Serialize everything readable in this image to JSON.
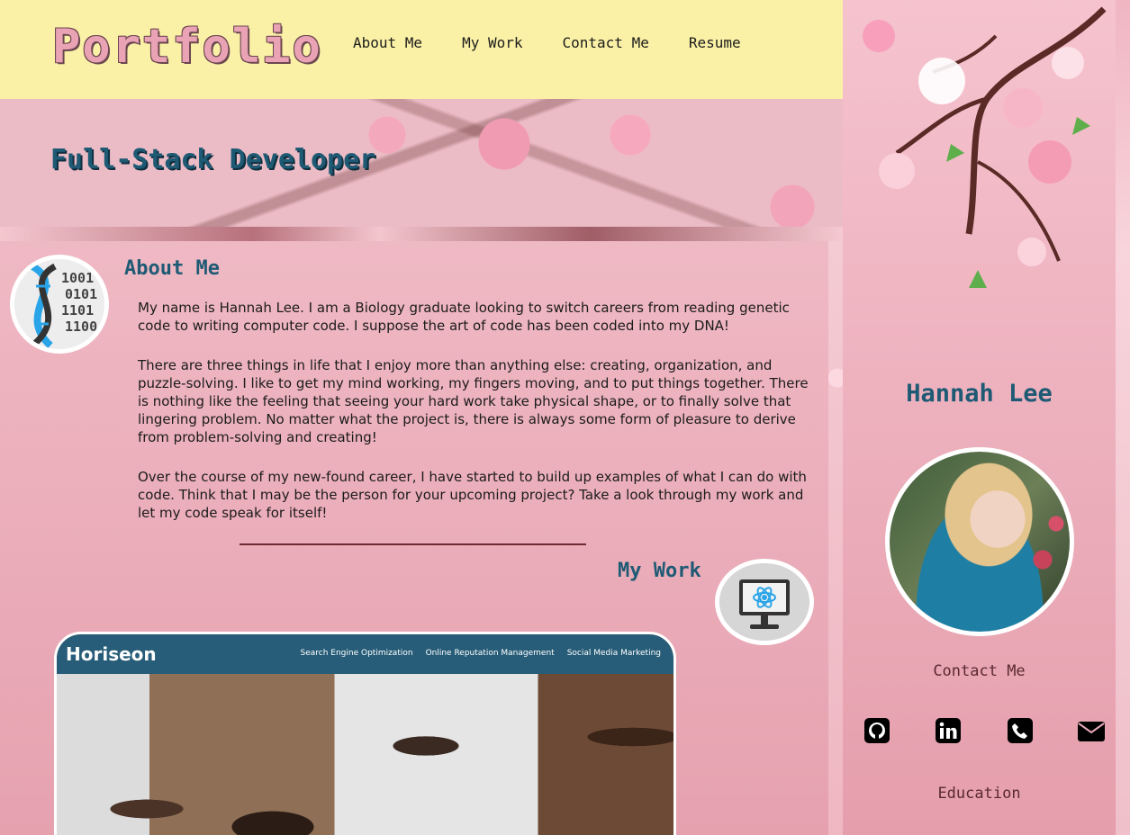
{
  "header": {
    "logo": "Portfolio",
    "nav": [
      "About Me",
      "My Work",
      "Contact Me",
      "Resume"
    ]
  },
  "hero": {
    "title": "Full-Stack Developer"
  },
  "about": {
    "heading": "About Me",
    "paragraphs": [
      "My name is Hannah Lee. I am a Biology graduate looking to switch careers from reading genetic code to writing computer code. I suppose the art of code has been coded into my DNA!",
      "There are three things in life that I enjoy more than anything else: creating, organization, and puzzle-solving. I like to get my mind working, my fingers moving, and to put things together. There is nothing like the feeling that seeing your hard work take physical shape, or to finally solve that lingering problem. No matter what the project is, there is always some form of pleasure to derive from problem-solving and creating!",
      "Over the course of my new-found career, I have started to build up examples of what I can do with code. Think that I may be the person for your upcoming project? Take a look through my work and let my code speak for itself!"
    ]
  },
  "work": {
    "heading": "My Work",
    "project": {
      "brand": "Horiseon",
      "links": [
        "Search Engine Optimization",
        "Online Reputation Management",
        "Social Media Marketing"
      ]
    }
  },
  "sidebar": {
    "name": "Hannah Lee",
    "contact_heading": "Contact Me",
    "education_heading": "Education",
    "social_icons": [
      "github-icon",
      "linkedin-icon",
      "phone-icon",
      "envelope-icon"
    ]
  },
  "colors": {
    "header_bg": "#faf1a6",
    "heading_blue": "#1f5a74",
    "logo_pink": "#e9a3b4",
    "divider": "#6e2a33"
  }
}
